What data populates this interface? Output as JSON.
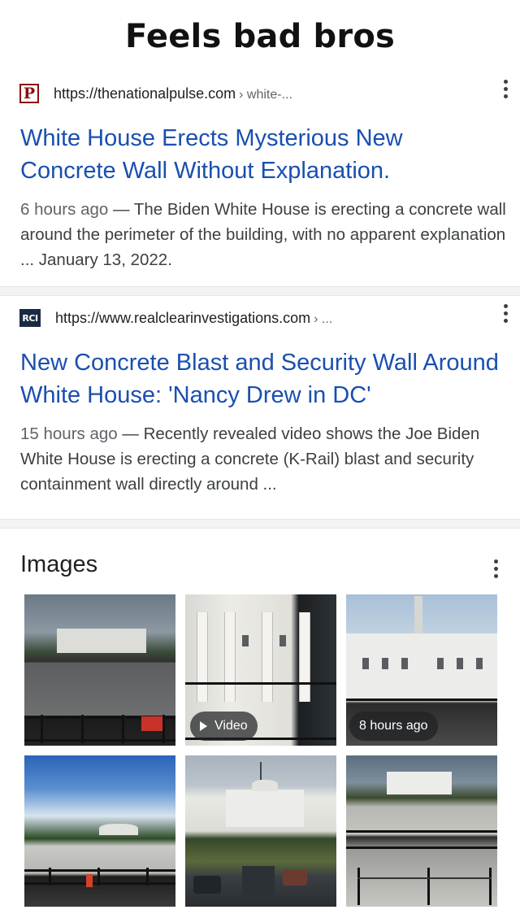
{
  "meme": {
    "title": "Feels bad bros"
  },
  "results": [
    {
      "favicon_text": "P",
      "url": "https://thenationalpulse.com",
      "url_tail": "› white-...",
      "headline": "White House Erects Mysterious New Concrete Wall Without Explanation.",
      "snippet_date": "6 hours ago",
      "snippet_text": " — The Biden White House is erecting a concrete wall around the perimeter of the building, with no apparent explanation ... January 13, 2022."
    },
    {
      "favicon_text": "RCI",
      "url": "https://www.realclearinvestigations.com",
      "url_tail": "› ...",
      "headline": "New Concrete Blast and Security Wall Around White House: 'Nancy Drew in DC'",
      "snippet_date": "15 hours ago",
      "snippet_text": " — Recently revealed video shows the Joe Biden White House is erecting a concrete (K-Rail) blast and security containment wall directly around ..."
    }
  ],
  "images": {
    "title": "Images",
    "video_label": "Video",
    "time_label": "8 hours ago"
  },
  "colors": {
    "link": "#1a4fb0",
    "text": "#202124",
    "divider": "#f1f3f4"
  }
}
